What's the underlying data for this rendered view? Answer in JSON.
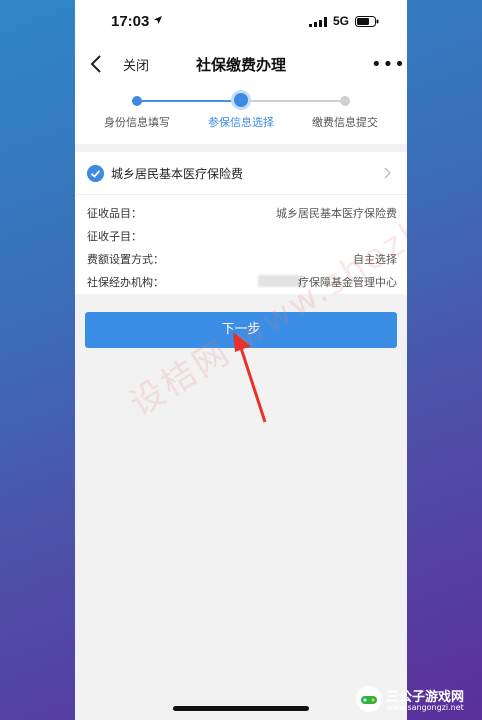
{
  "status": {
    "time": "17:03",
    "network": "5G"
  },
  "nav": {
    "close_label": "关闭",
    "title": "社保缴费办理",
    "more": "•••"
  },
  "steps": [
    {
      "label": "身份信息填写"
    },
    {
      "label": "参保信息选择"
    },
    {
      "label": "缴费信息提交"
    }
  ],
  "selected_item": {
    "label": "城乡居民基本医疗保险费"
  },
  "details": [
    {
      "key": "征收品目：",
      "value": "城乡居民基本医疗保险费"
    },
    {
      "key": "征收子目：",
      "value": ""
    },
    {
      "key": "费额设置方式：",
      "value": "自主选择"
    },
    {
      "key": "社保经办机构：",
      "value": "疗保障基金管理中心"
    }
  ],
  "next_button": {
    "label": "下一步"
  },
  "watermark": {
    "text": "设桔网 www.shezhan8"
  },
  "brand": {
    "name": "三公子游戏网",
    "url": "www.sangongzi.net"
  },
  "colors": {
    "accent": "#3a8ee6",
    "inactive": "#cfcfcf"
  }
}
